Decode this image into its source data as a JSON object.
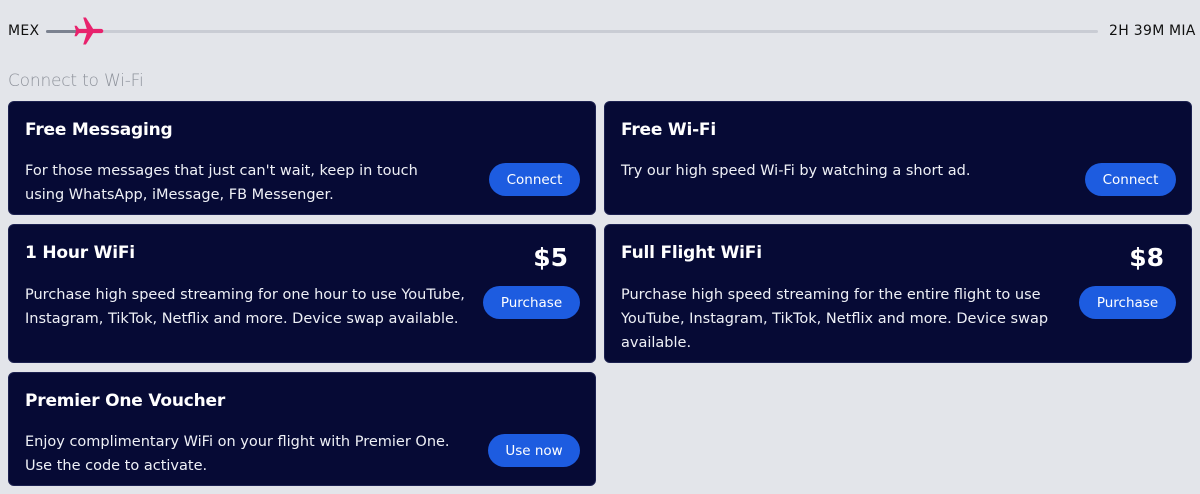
{
  "flight": {
    "origin": "MEX",
    "destination": "MIA",
    "remaining": "2H 39M",
    "progress_fraction": 0.04
  },
  "section_title": "Connect to Wi-Fi",
  "cards": [
    {
      "title": "Free Messaging",
      "description": "For those messages that just can't wait, keep in touch using WhatsApp, iMessage, FB Messenger.",
      "button": "Connect"
    },
    {
      "title": "Free Wi-Fi",
      "description": "Try our high speed Wi-Fi by watching a short ad.",
      "button": "Connect"
    },
    {
      "title": "1 Hour WiFi",
      "price": "$5",
      "description": "Purchase high speed streaming for one hour to use YouTube, Instagram, TikTok, Netflix and more. Device swap available.",
      "button": "Purchase"
    },
    {
      "title": "Full Flight WiFi",
      "price": "$8",
      "description": "Purchase high speed streaming for the entire flight to use YouTube, Instagram, TikTok, Netflix and more. Device swap available.",
      "button": "Purchase"
    },
    {
      "title": "Premier One Voucher",
      "description": "Enjoy complimentary WiFi on your flight with Premier One. Use the code to activate.",
      "button": "Use now"
    }
  ],
  "colors": {
    "background": "#e3e5ea",
    "card": "#060a35",
    "button": "#1d5ce0",
    "plane": "#e8226d"
  },
  "icons": {
    "plane": "airplane-icon"
  }
}
